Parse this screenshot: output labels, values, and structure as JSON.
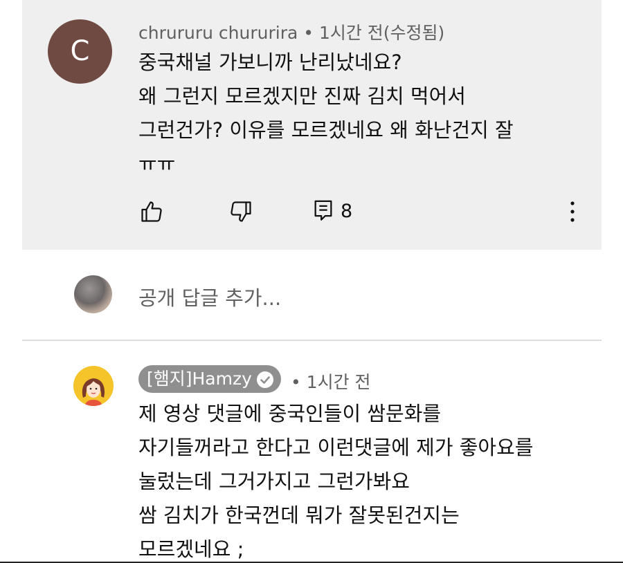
{
  "comment1": {
    "avatar_letter": "C",
    "avatar_color": "#6f4a43",
    "author": "chrururu chururira",
    "separator": "•",
    "time": "1시간 전(수정됨)",
    "lines": [
      "중국채널 가보니까 난리났네요?",
      "왜 그런지 모르겠지만 진짜 김치 먹어서",
      "그런건가? 이유를 모르겠네요 왜 화난건지 잘",
      "ㅠㅠ"
    ],
    "actions": {
      "like_icon": "thumbs-up-icon",
      "dislike_icon": "thumbs-down-icon",
      "reply_icon": "reply-comment-icon",
      "reply_count": "8",
      "more_icon": "more-vertical-icon"
    }
  },
  "reply_box": {
    "placeholder": "공개 답글 추가..."
  },
  "comment2": {
    "author": "[햄지]Hamzy",
    "verified_icon": "verified-check-icon",
    "separator": "•",
    "time": "1시간 전",
    "lines": [
      "제 영상 댓글에  중국인들이 쌈문화를",
      "자기들꺼라고 한다고 이런댓글에 제가 좋아요를",
      "눌렀는데 그거가지고 그런가봐요",
      "쌈 김치가 한국껀데 뭐가 잘못된건지는",
      "모르겠네요 ;"
    ]
  },
  "colors": {
    "highlight_bg": "#efefef",
    "meta_text": "#606060",
    "chip_bg": "#8f8f8f",
    "hamzy_avatar_bg": "#f4c42a"
  }
}
